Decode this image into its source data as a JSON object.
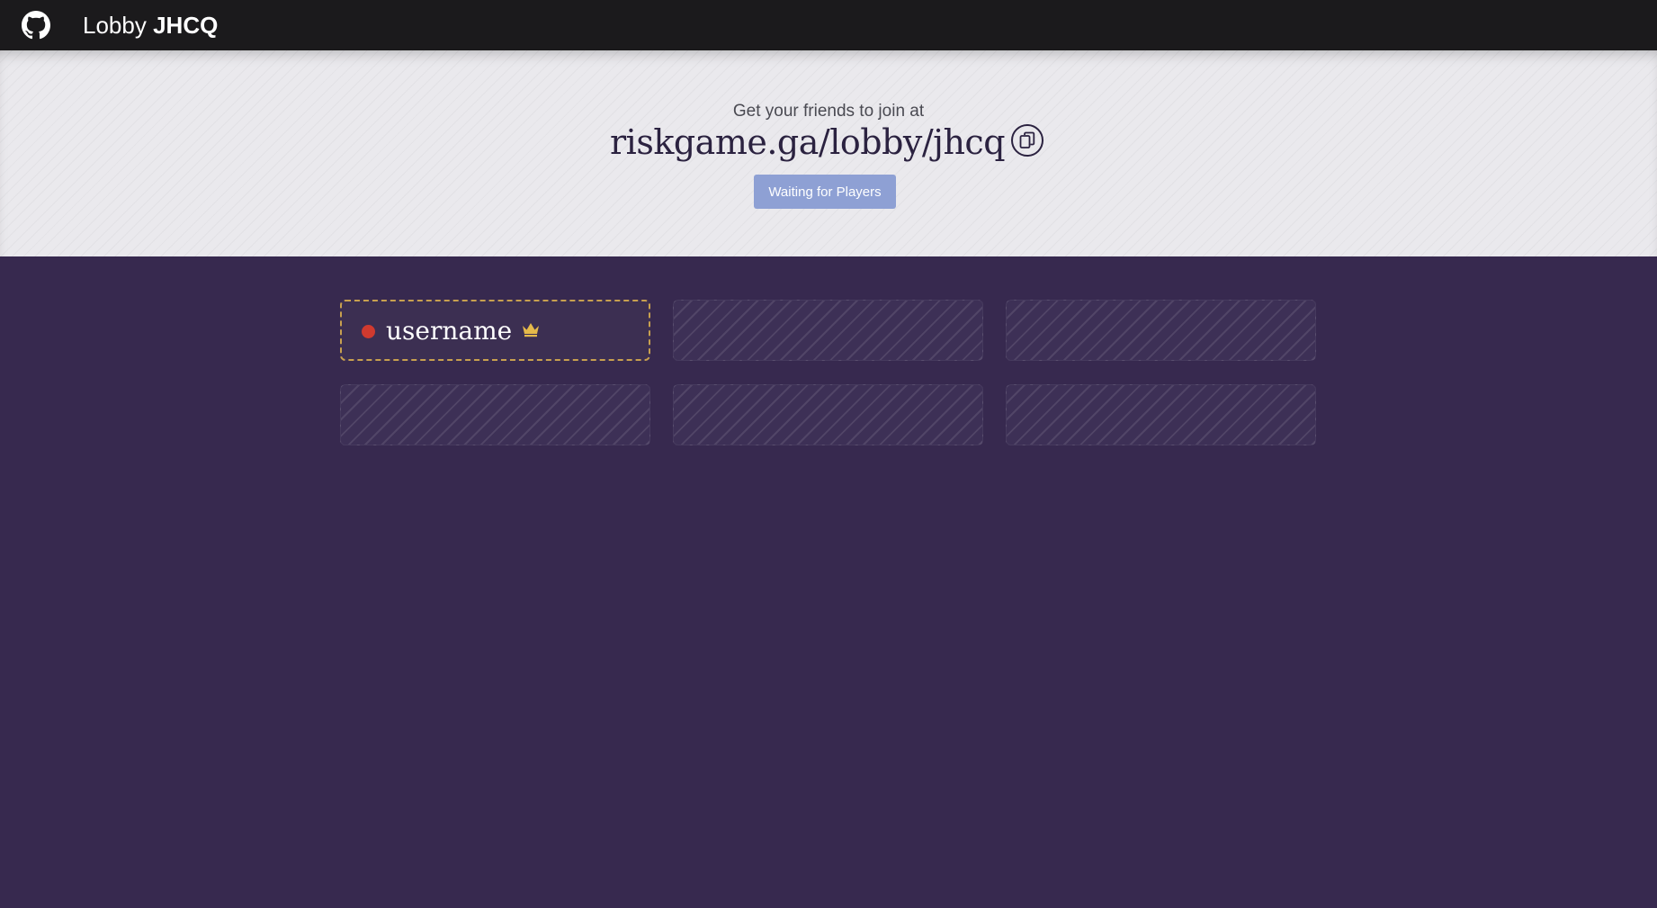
{
  "header": {
    "title_prefix": "Lobby",
    "lobby_code": "JHCQ",
    "github_icon": "github-icon"
  },
  "invite": {
    "prompt": "Get your friends to join at",
    "url": "riskgame.ga/lobby/jhcq",
    "copy_icon": "copy-icon"
  },
  "status_button": {
    "label": "Waiting for Players"
  },
  "players": {
    "slots": [
      {
        "type": "player",
        "name": "username",
        "status_color": "#d03a2f",
        "is_host": true,
        "host_icon": "crown-icon"
      },
      {
        "type": "empty"
      },
      {
        "type": "empty"
      },
      {
        "type": "empty"
      },
      {
        "type": "empty"
      },
      {
        "type": "empty"
      }
    ]
  },
  "colors": {
    "topbar": "#1b1a1c",
    "banner": "#eae9ed",
    "background": "#37294f",
    "button": "#8ea0d4",
    "host_border": "#c8a04f"
  }
}
